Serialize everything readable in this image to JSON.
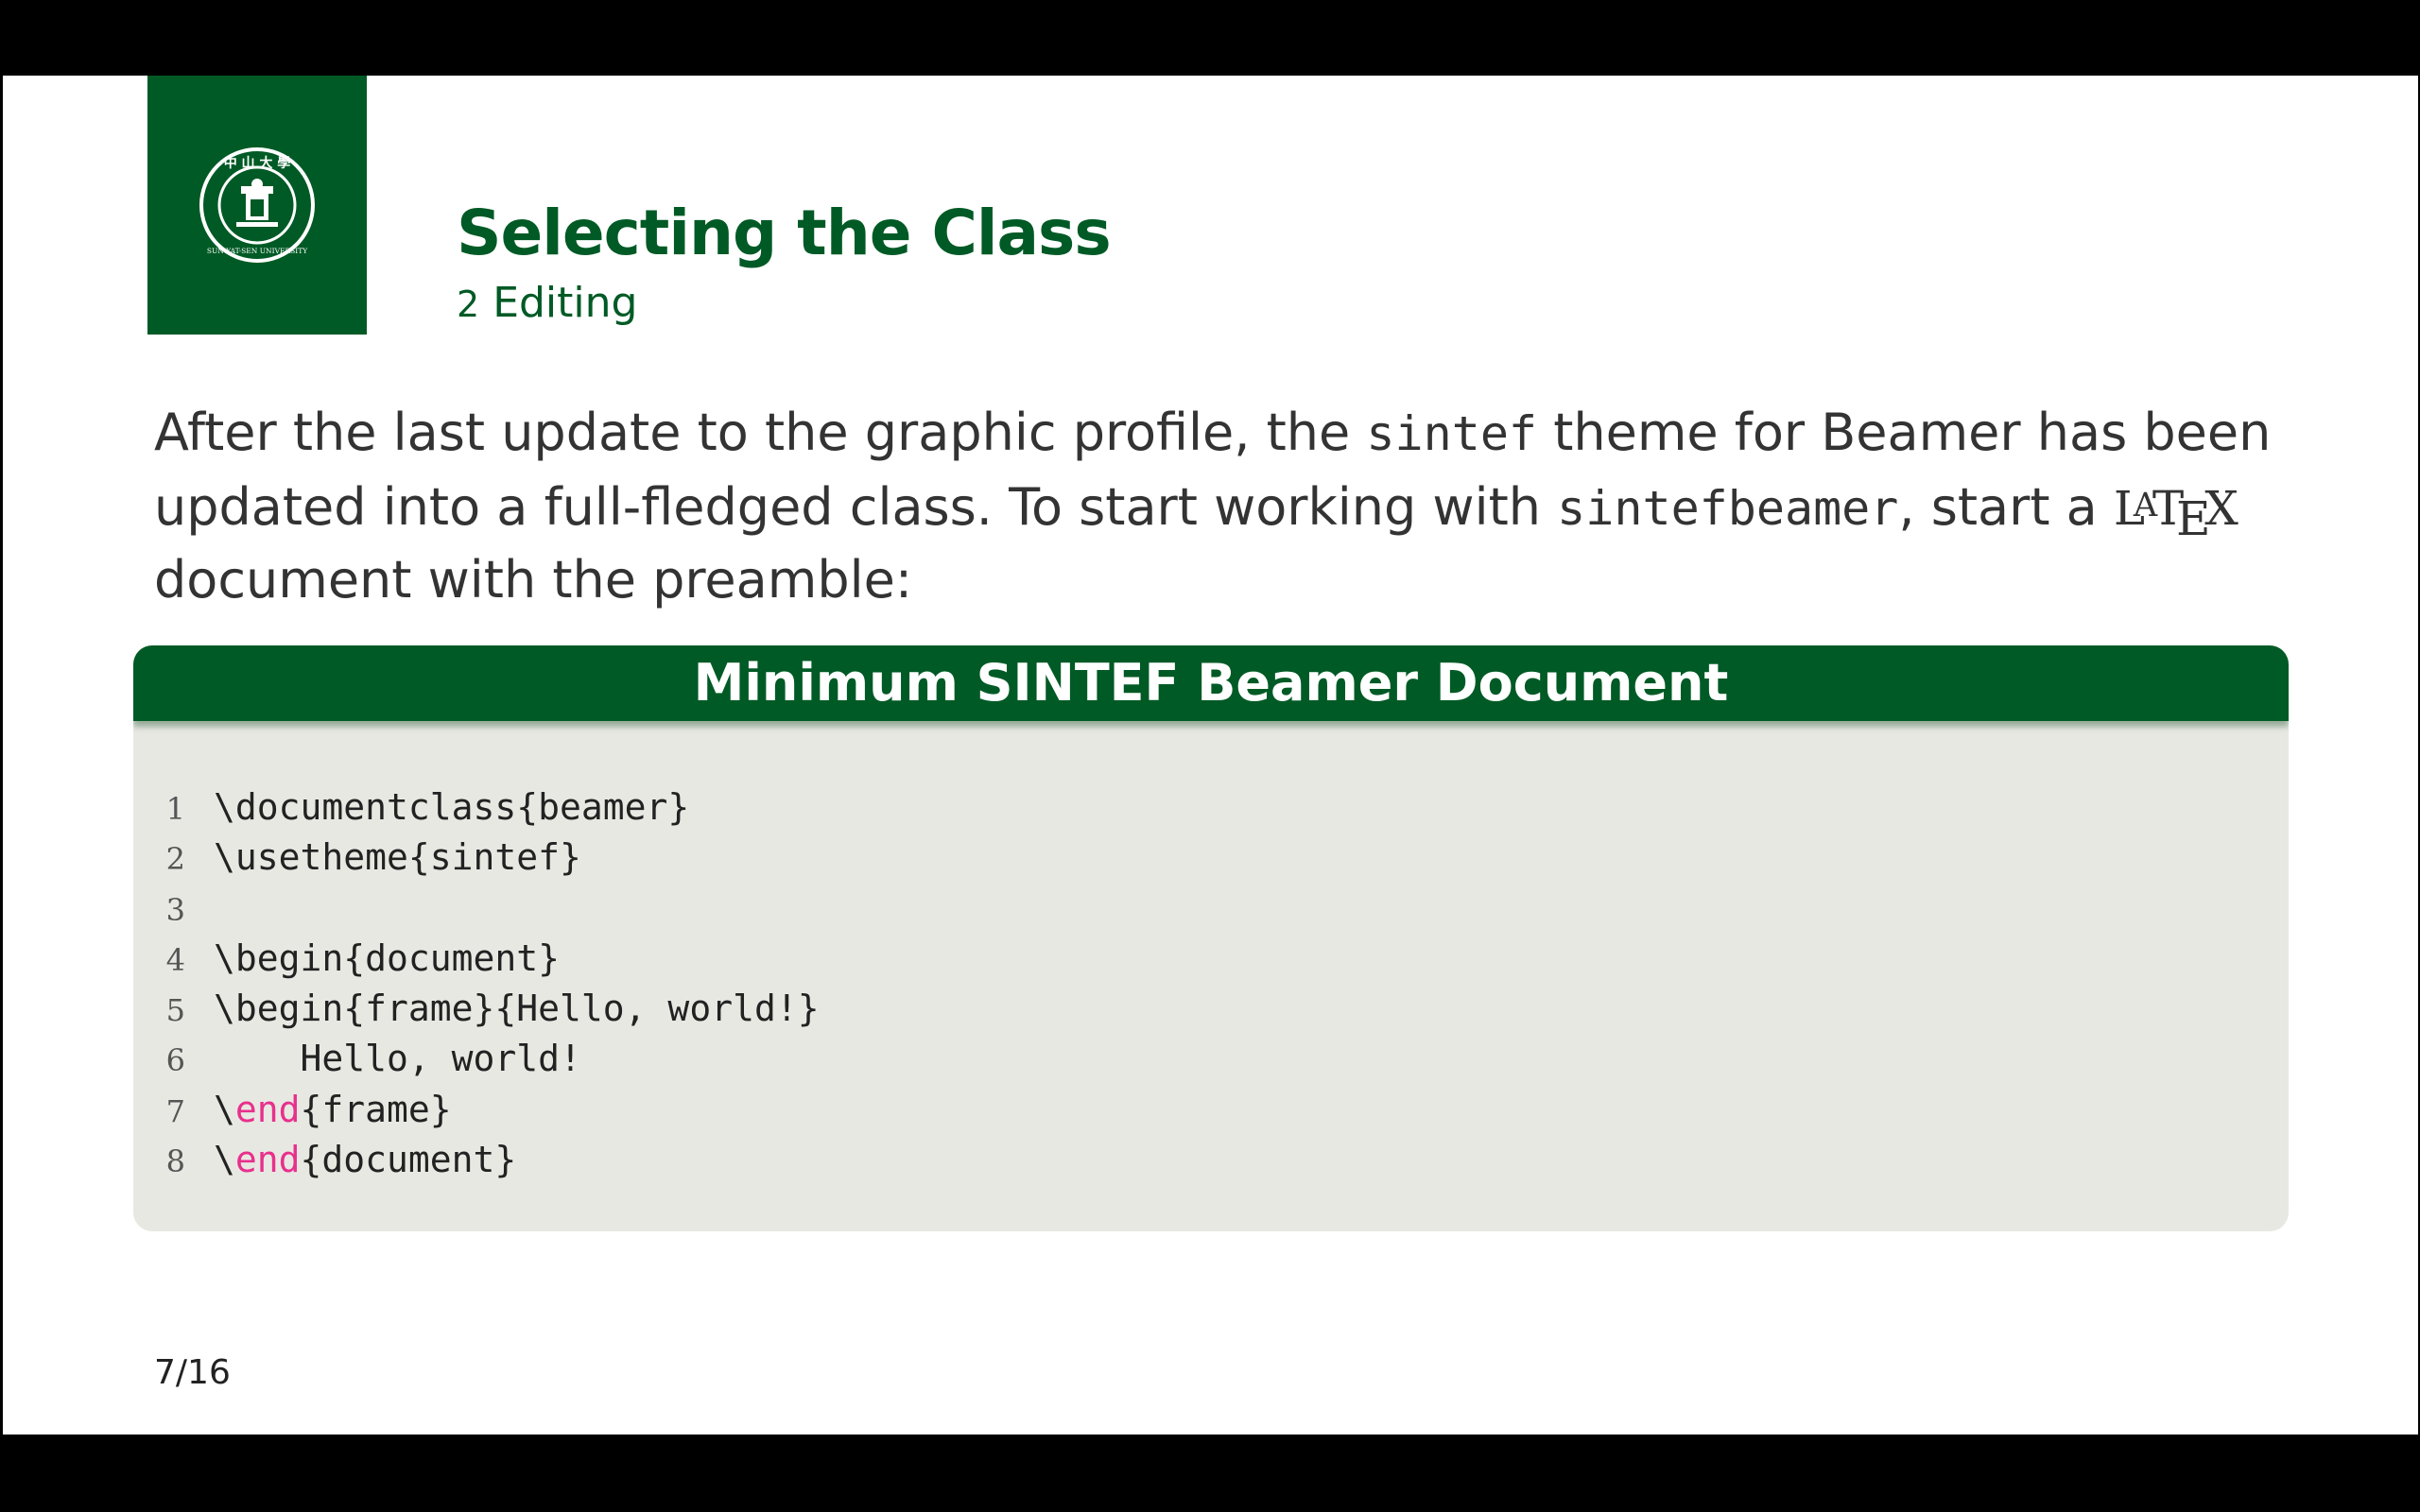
{
  "slide": {
    "title": "Selecting the Class",
    "section_number": "2",
    "section_name": "Editing",
    "paragraph": {
      "part1": "After the last update to the graphic profile, the ",
      "mono1": "sintef",
      "part2": " theme for Beamer has been updated into a full-fledged class.  To start working with ",
      "mono2": "sintefbeamer",
      "part3": ", start a ",
      "latex": "LaTeX",
      "part4": " document with the preamble:"
    },
    "block": {
      "title": "Minimum SINTEF Beamer Document",
      "lines": [
        {
          "num": "1",
          "pre": "\\documentclass{beamer}",
          "kw": "",
          "post": ""
        },
        {
          "num": "2",
          "pre": "\\usetheme{sintef}",
          "kw": "",
          "post": ""
        },
        {
          "num": "3",
          "pre": "",
          "kw": "",
          "post": ""
        },
        {
          "num": "4",
          "pre": "\\begin{document}",
          "kw": "",
          "post": ""
        },
        {
          "num": "5",
          "pre": "\\begin{frame}{Hello, world!}",
          "kw": "",
          "post": ""
        },
        {
          "num": "6",
          "pre": "    Hello, world!",
          "kw": "",
          "post": ""
        },
        {
          "num": "7",
          "pre": "\\",
          "kw": "end",
          "post": "{frame}"
        },
        {
          "num": "8",
          "pre": "\\",
          "kw": "end",
          "post": "{document}"
        }
      ]
    },
    "page_number": "7/16",
    "logo_text": "SUN YAT-SEN UNIVERSITY",
    "colors": {
      "primary_green": "#005a25",
      "code_background": "#e8e8e3",
      "keyword": "#e8308c"
    }
  }
}
